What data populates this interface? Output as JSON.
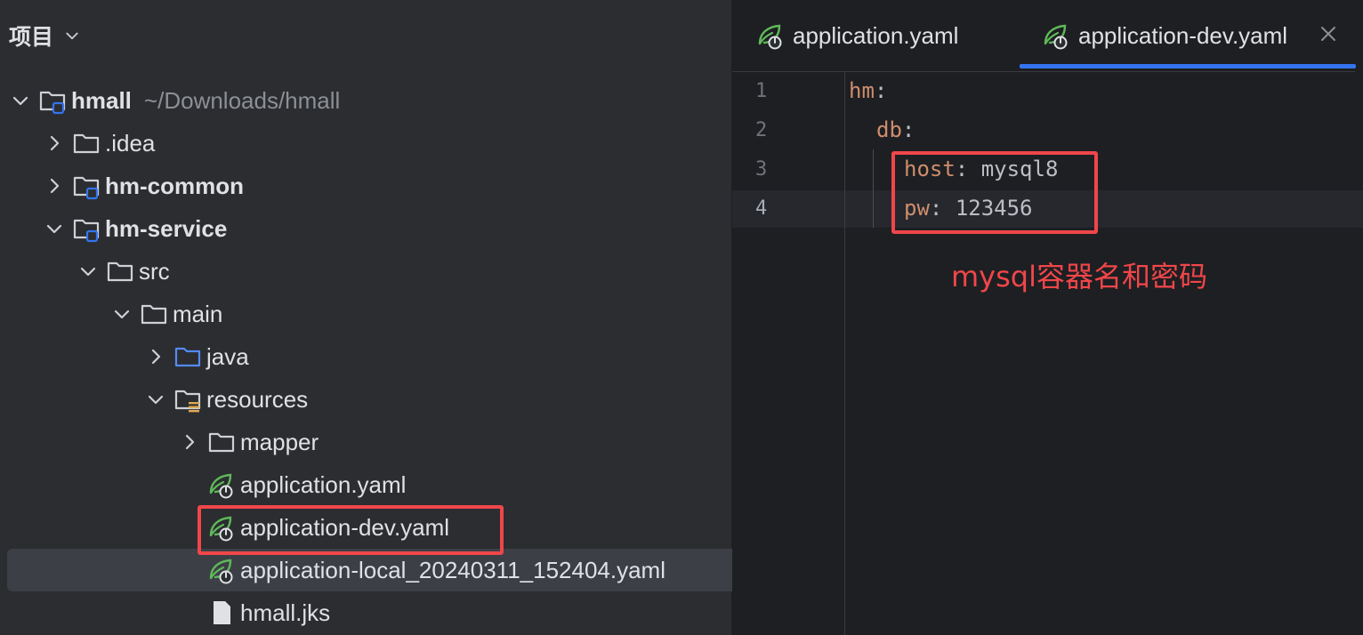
{
  "panel": {
    "title": "项目",
    "tree": [
      {
        "label": "hmall",
        "path": "~/Downloads/hmall",
        "icon": "module-folder-icon",
        "expanded": true
      },
      {
        "label": ".idea",
        "icon": "folder-icon",
        "expanded": false
      },
      {
        "label": "hm-common",
        "icon": "module-folder-icon",
        "expanded": false
      },
      {
        "label": "hm-service",
        "icon": "module-folder-icon",
        "expanded": true
      },
      {
        "label": "src",
        "icon": "folder-icon",
        "expanded": true
      },
      {
        "label": "main",
        "icon": "folder-icon",
        "expanded": true
      },
      {
        "label": "java",
        "icon": "source-folder-icon",
        "expanded": false
      },
      {
        "label": "resources",
        "icon": "resources-folder-icon",
        "expanded": true
      },
      {
        "label": "mapper",
        "icon": "folder-icon",
        "expanded": false
      },
      {
        "label": "application.yaml",
        "icon": "spring-yaml-icon"
      },
      {
        "label": "application-dev.yaml",
        "icon": "spring-yaml-icon"
      },
      {
        "label": "application-local_20240311_152404.yaml",
        "icon": "spring-yaml-icon"
      },
      {
        "label": "hmall.jks",
        "icon": "file-icon"
      }
    ]
  },
  "editor": {
    "tabs": [
      {
        "label": "application.yaml",
        "icon": "spring-yaml-icon",
        "active": false
      },
      {
        "label": "application-dev.yaml",
        "icon": "spring-yaml-icon",
        "active": true
      }
    ],
    "lines": [
      {
        "no": "1",
        "key": "hm",
        "sep": ":",
        "value": ""
      },
      {
        "no": "2",
        "key": "db",
        "sep": ":",
        "value": ""
      },
      {
        "no": "3",
        "key": "host",
        "sep": ": ",
        "value": "mysql8"
      },
      {
        "no": "4",
        "key": "pw",
        "sep": ": ",
        "value": "123456"
      }
    ],
    "annotation": "mysql容器名和密码"
  },
  "colors": {
    "highlight": "#f0464a",
    "yaml_key": "#cf8e6d",
    "tab_underline": "#3574f0",
    "spring_green": "#5fb85a"
  }
}
